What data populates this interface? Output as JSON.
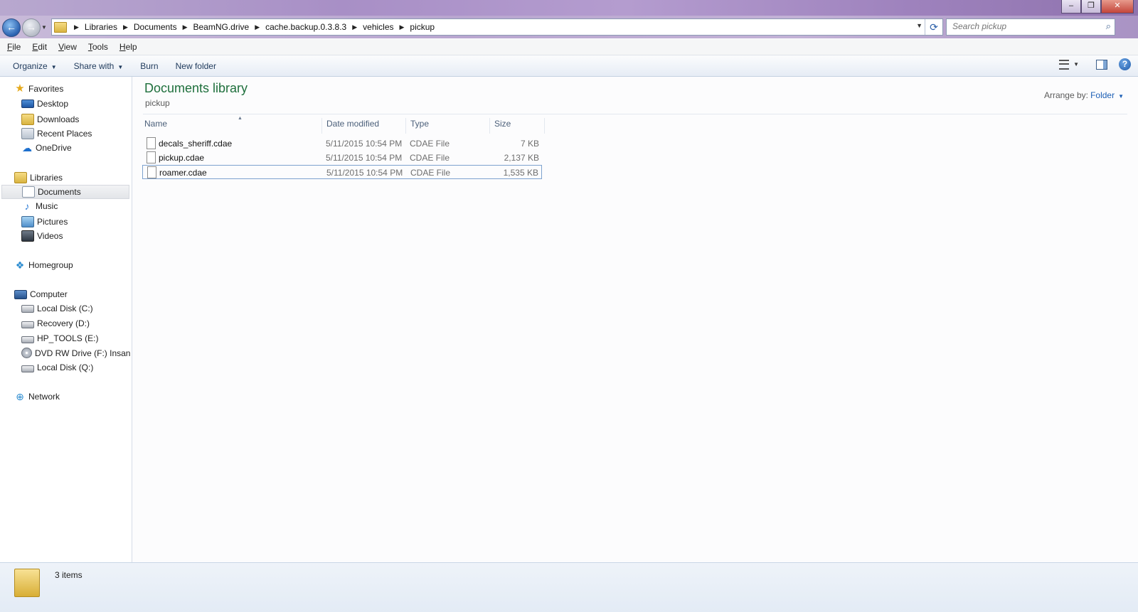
{
  "window": {
    "minimize": "–",
    "maximize": "❐",
    "close": "✕"
  },
  "nav": {
    "back_icon": "←",
    "forward_icon": "→",
    "breadcrumb": [
      "Libraries",
      "Documents",
      "BeamNG.drive",
      "cache.backup.0.3.8.3",
      "vehicles",
      "pickup"
    ],
    "search_placeholder": "Search pickup"
  },
  "menu": {
    "items": [
      {
        "acc": "F",
        "rest": "ile"
      },
      {
        "acc": "E",
        "rest": "dit"
      },
      {
        "acc": "V",
        "rest": "iew"
      },
      {
        "acc": "T",
        "rest": "ools"
      },
      {
        "acc": "H",
        "rest": "elp"
      }
    ]
  },
  "toolbar": {
    "organize": "Organize",
    "share_with": "Share with",
    "burn": "Burn",
    "new_folder": "New folder",
    "help": "?"
  },
  "sidebar": {
    "favorites": "Favorites",
    "favorites_items": [
      "Desktop",
      "Downloads",
      "Recent Places",
      "OneDrive"
    ],
    "libraries": "Libraries",
    "libraries_items": [
      "Documents",
      "Music",
      "Pictures",
      "Videos"
    ],
    "homegroup": "Homegroup",
    "computer": "Computer",
    "computer_items": [
      "Local Disk (C:)",
      "Recovery (D:)",
      "HP_TOOLS (E:)",
      "DVD RW Drive (F:) Insanity",
      "Local Disk (Q:)"
    ],
    "network": "Network"
  },
  "content": {
    "library_title": "Documents library",
    "library_subtitle": "pickup",
    "arrange_label": "Arrange by:",
    "arrange_value": "Folder",
    "columns": [
      "Name",
      "Date modified",
      "Type",
      "Size"
    ],
    "files": [
      {
        "name": "decals_sheriff.cdae",
        "date": "5/11/2015 10:54 PM",
        "type": "CDAE File",
        "size": "7 KB"
      },
      {
        "name": "pickup.cdae",
        "date": "5/11/2015 10:54 PM",
        "type": "CDAE File",
        "size": "2,137 KB"
      },
      {
        "name": "roamer.cdae",
        "date": "5/11/2015 10:54 PM",
        "type": "CDAE File",
        "size": "1,535 KB"
      }
    ]
  },
  "details": {
    "item_count": "3 items"
  }
}
